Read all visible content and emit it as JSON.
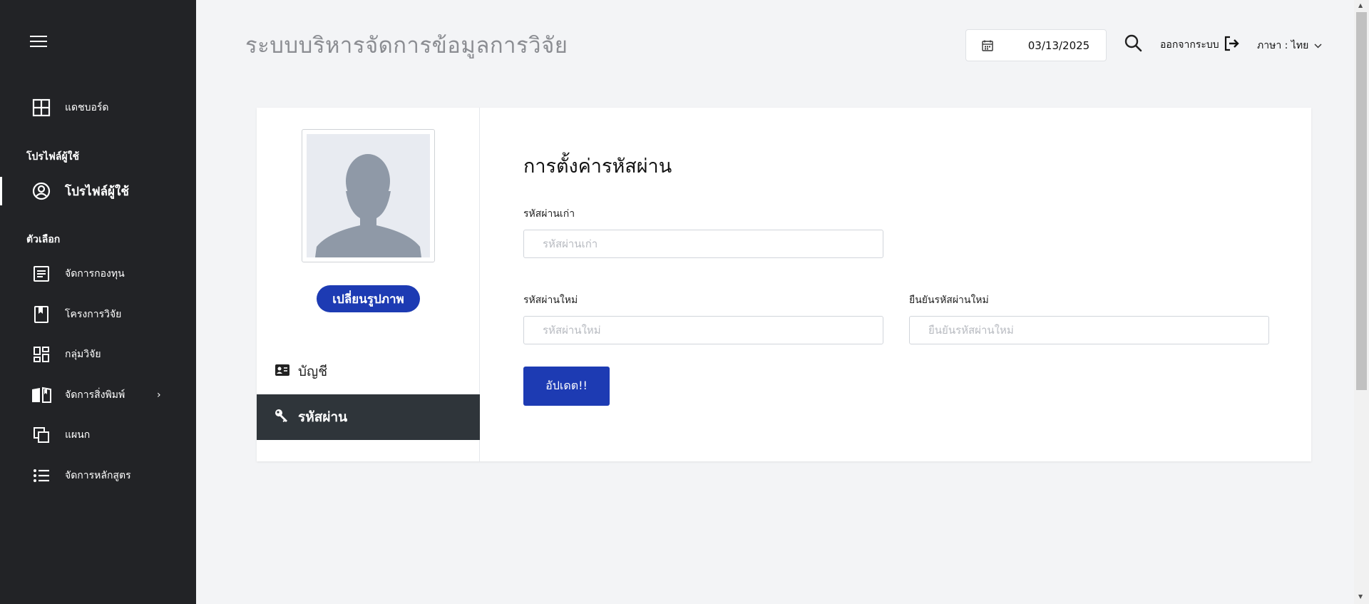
{
  "header": {
    "app_title": "ระบบบริหารจัดการข้อมูลการวิจัย",
    "date": "03/13/2025",
    "logout_label": "ออกจากระบบ",
    "language_label": "ภาษา : ไทย"
  },
  "sidebar": {
    "dashboard": "แดชบอร์ด",
    "section_profile": "โปรไฟล์ผู้ใช้",
    "profile": "โปรไฟล์ผู้ใช้",
    "section_options": "ตัวเลือก",
    "items": [
      {
        "label": "จัดการกองทุน",
        "icon": "document-icon"
      },
      {
        "label": "โครงการวิจัย",
        "icon": "bookmark-icon"
      },
      {
        "label": "กลุ่มวิจัย",
        "icon": "dashboard-grid-icon"
      },
      {
        "label": "จัดการสิ่งพิมพ์",
        "icon": "open-book-icon"
      },
      {
        "label": "แผนก",
        "icon": "copy-icon"
      },
      {
        "label": "จัดการหลักสูตร",
        "icon": "list-icon"
      }
    ]
  },
  "profile_panel": {
    "change_image_label": "เปลี่ยนรูปภาพ",
    "tabs": [
      {
        "label": "บัญชี",
        "icon": "id-card-icon"
      },
      {
        "label": "รหัสผ่าน",
        "icon": "key-icon"
      }
    ]
  },
  "password_form": {
    "title": "การตั้งค่ารหัสผ่าน",
    "old_password_label": "รหัสผ่านเก่า",
    "old_password_placeholder": "รหัสผ่านเก่า",
    "new_password_label": "รหัสผ่านใหม่",
    "new_password_placeholder": "รหัสผ่านใหม่",
    "confirm_password_label": "ยืนยันรหัสผ่านใหม่",
    "confirm_password_placeholder": "ยืนยันรหัสผ่านใหม่",
    "update_label": "อัปเดต!!"
  },
  "colors": {
    "sidebar_bg": "#222326",
    "primary": "#1d3bb3",
    "active_tab": "#2f353a"
  }
}
